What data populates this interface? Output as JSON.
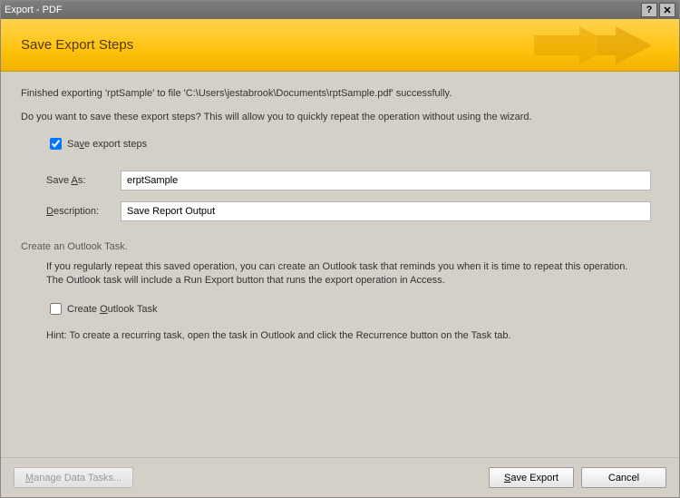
{
  "window": {
    "title": "Export - PDF",
    "help_symbol": "?",
    "close_symbol": "✕"
  },
  "banner": {
    "title": "Save Export Steps"
  },
  "content": {
    "finished_text": "Finished exporting 'rptSample' to file 'C:\\Users\\jestabrook\\Documents\\rptSample.pdf' successfully.",
    "question_text": "Do you want to save these export steps? This will allow you to quickly repeat the operation without using the wizard.",
    "save_steps_label_pre": "Sa",
    "save_steps_label_u": "v",
    "save_steps_label_post": "e export steps",
    "save_steps_checked": true,
    "save_as_label_u": "A",
    "save_as_label_post": ":",
    "save_as_label_pre": "Save ",
    "save_as_label_post2": "s:",
    "save_as_value": "erptSample",
    "description_label_u": "D",
    "description_label_post": "escription:",
    "description_value": "Save Report Output",
    "outlook_section_label": "Create an Outlook Task.",
    "outlook_para1": "If you regularly repeat this saved operation, you can create an Outlook task that reminds you when it is time to repeat this operation.",
    "outlook_para2": "The Outlook task will include a Run Export button that runs the export operation in Access.",
    "create_outlook_label_pre": "Create ",
    "create_outlook_label_u": "O",
    "create_outlook_label_post": "utlook Task",
    "create_outlook_checked": false,
    "hint_text": "Hint: To create a recurring task, open the task in Outlook and click the Recurrence button on the Task tab."
  },
  "buttons": {
    "manage_label_u": "M",
    "manage_label_post": "anage Data Tasks...",
    "save_export_label_u": "S",
    "save_export_label_post": "ave Export",
    "cancel_label": "Cancel"
  }
}
